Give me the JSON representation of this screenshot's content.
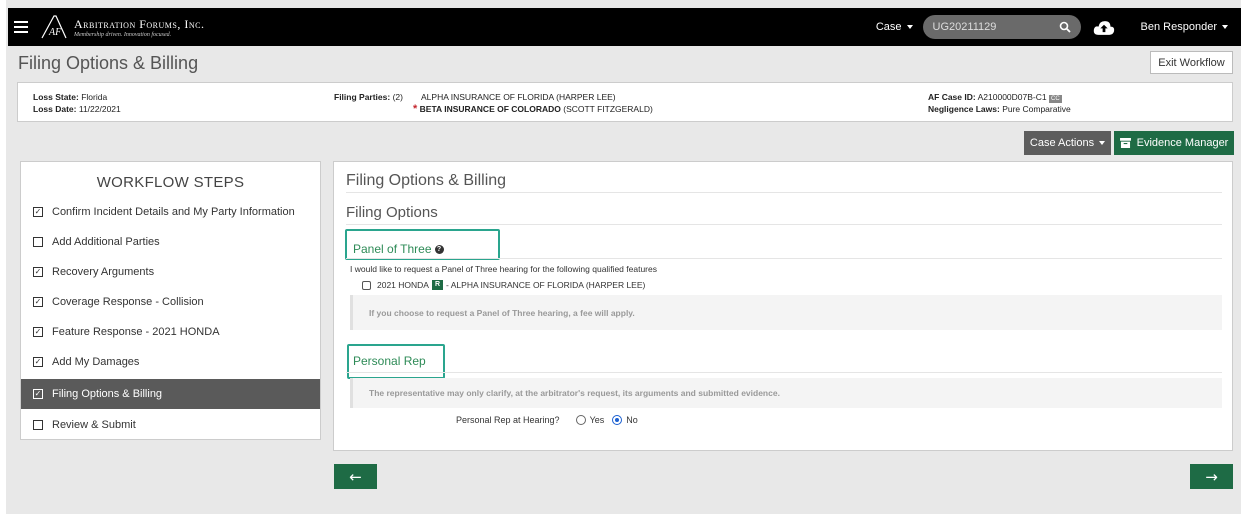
{
  "header": {
    "brand_name": "Arbitration Forums, Inc.",
    "brand_tagline": "Membership driven. Innovation focused.",
    "case_dropdown": "Case",
    "search_value": "UG20211129",
    "user_name": "Ben Responder"
  },
  "page": {
    "title": "Filing Options & Billing",
    "exit_button": "Exit Workflow"
  },
  "info": {
    "loss_state_label": "Loss State:",
    "loss_state": "Florida",
    "loss_date_label": "Loss Date:",
    "loss_date": "11/22/2021",
    "filing_parties_label": "Filing Parties:",
    "filing_parties_count": "(2)",
    "party1": "ALPHA INSURANCE OF FLORIDA",
    "party1_contact": "(HARPER LEE)",
    "party2": "BETA INSURANCE OF COLORADO",
    "party2_contact": "(SCOTT FITZGERALD)",
    "case_id_label": "AF Case ID:",
    "case_id": "A210000D07B-C1",
    "case_id_badge": "CC",
    "negligence_label": "Negligence Laws:",
    "negligence": "Pure Comparative"
  },
  "actions": {
    "case_actions": "Case Actions",
    "evidence_manager": "Evidence Manager"
  },
  "workflow": {
    "heading": "WORKFLOW STEPS",
    "steps": [
      {
        "label": "Confirm Incident Details and My Party Information",
        "checked": true
      },
      {
        "label": "Add Additional Parties",
        "checked": false
      },
      {
        "label": "Recovery Arguments",
        "checked": true
      },
      {
        "label": "Coverage Response - Collision",
        "checked": true
      },
      {
        "label": "Feature Response - 2021 HONDA",
        "checked": true
      },
      {
        "label": "Add My Damages",
        "checked": true
      },
      {
        "label": "Filing Options & Billing",
        "checked": true,
        "active": true
      },
      {
        "label": "Review & Submit",
        "checked": false
      }
    ]
  },
  "main": {
    "heading": "Filing Options & Billing",
    "subheading": "Filing Options",
    "panel": {
      "label": "Panel of Three",
      "request_text": "I would like to request a Panel of Three hearing for the following qualified features",
      "feature_vehicle": "2021 HONDA",
      "feature_badge": "R",
      "feature_party": "- ALPHA INSURANCE OF FLORIDA (HARPER LEE)",
      "note": "If you choose to request a Panel of Three hearing, a fee will apply."
    },
    "rep": {
      "label": "Personal Rep",
      "note": "The representative may only clarify, at the arbitrator's request, its arguments and submitted evidence.",
      "question": "Personal Rep at Hearing?",
      "yes": "Yes",
      "no": "No",
      "selected": "No"
    }
  },
  "nav": {
    "back_glyph": "←",
    "next_glyph": "→"
  },
  "colors": {
    "accent_green": "#1e6b45",
    "highlight_teal": "#2aa58e",
    "required_red": "#c4262e"
  }
}
